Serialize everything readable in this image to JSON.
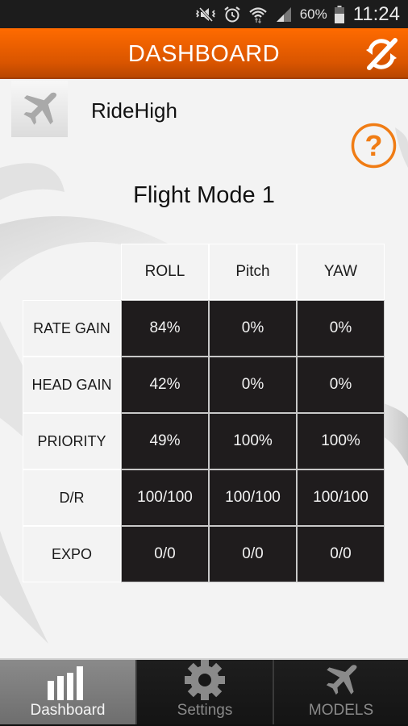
{
  "status_bar": {
    "icons": [
      "silent-vibrate-icon",
      "alarm-icon",
      "wifi-icon",
      "signal-icon",
      "battery-icon"
    ],
    "battery_percent": "60%",
    "time": "11:24"
  },
  "action_bar": {
    "title": "DASHBOARD",
    "sync_icon": "sync-disabled-icon"
  },
  "model": {
    "icon": "airplane-icon",
    "name": "RideHigh"
  },
  "help": {
    "icon": "help-icon",
    "label": "?"
  },
  "flight_mode": {
    "title": "Flight Mode 1"
  },
  "table": {
    "columns": [
      "ROLL",
      "Pitch",
      "YAW"
    ],
    "rows": [
      {
        "label": "RATE GAIN",
        "values": [
          "84%",
          "0%",
          "0%"
        ]
      },
      {
        "label": "HEAD GAIN",
        "values": [
          "42%",
          "0%",
          "0%"
        ]
      },
      {
        "label": "PRIORITY",
        "values": [
          "49%",
          "100%",
          "100%"
        ]
      },
      {
        "label": "D/R",
        "values": [
          "100/100",
          "100/100",
          "100/100"
        ]
      },
      {
        "label": "EXPO",
        "values": [
          "0/0",
          "0/0",
          "0/0"
        ]
      }
    ]
  },
  "tabs": [
    {
      "label": "Dashboard",
      "icon": "bar-chart-icon",
      "active": true
    },
    {
      "label": "Settings",
      "icon": "gear-icon",
      "active": false
    },
    {
      "label": "MODELS",
      "icon": "airplane-icon",
      "active": false
    }
  ],
  "colors": {
    "accent": "#ff6b00",
    "cell_dark": "#1f1c1d",
    "background": "#f3f3f3"
  }
}
